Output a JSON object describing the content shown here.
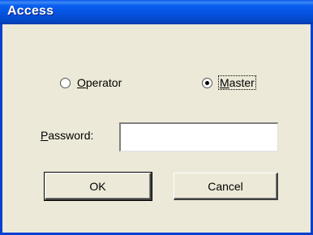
{
  "window": {
    "title": "Access"
  },
  "role": {
    "options": [
      {
        "label": "Operator",
        "mnemonic": "O",
        "rest": "perator",
        "selected": false
      },
      {
        "label": "Master",
        "mnemonic": "M",
        "rest": "aster",
        "selected": true
      }
    ]
  },
  "password": {
    "label": "Password:",
    "mnemonic": "P",
    "rest": "assword:",
    "value": ""
  },
  "buttons": {
    "ok": "OK",
    "cancel": "Cancel"
  },
  "colors": {
    "titlebar": "#0655e4",
    "window_bg": "#ece9d8",
    "frame": "#0841d0"
  }
}
